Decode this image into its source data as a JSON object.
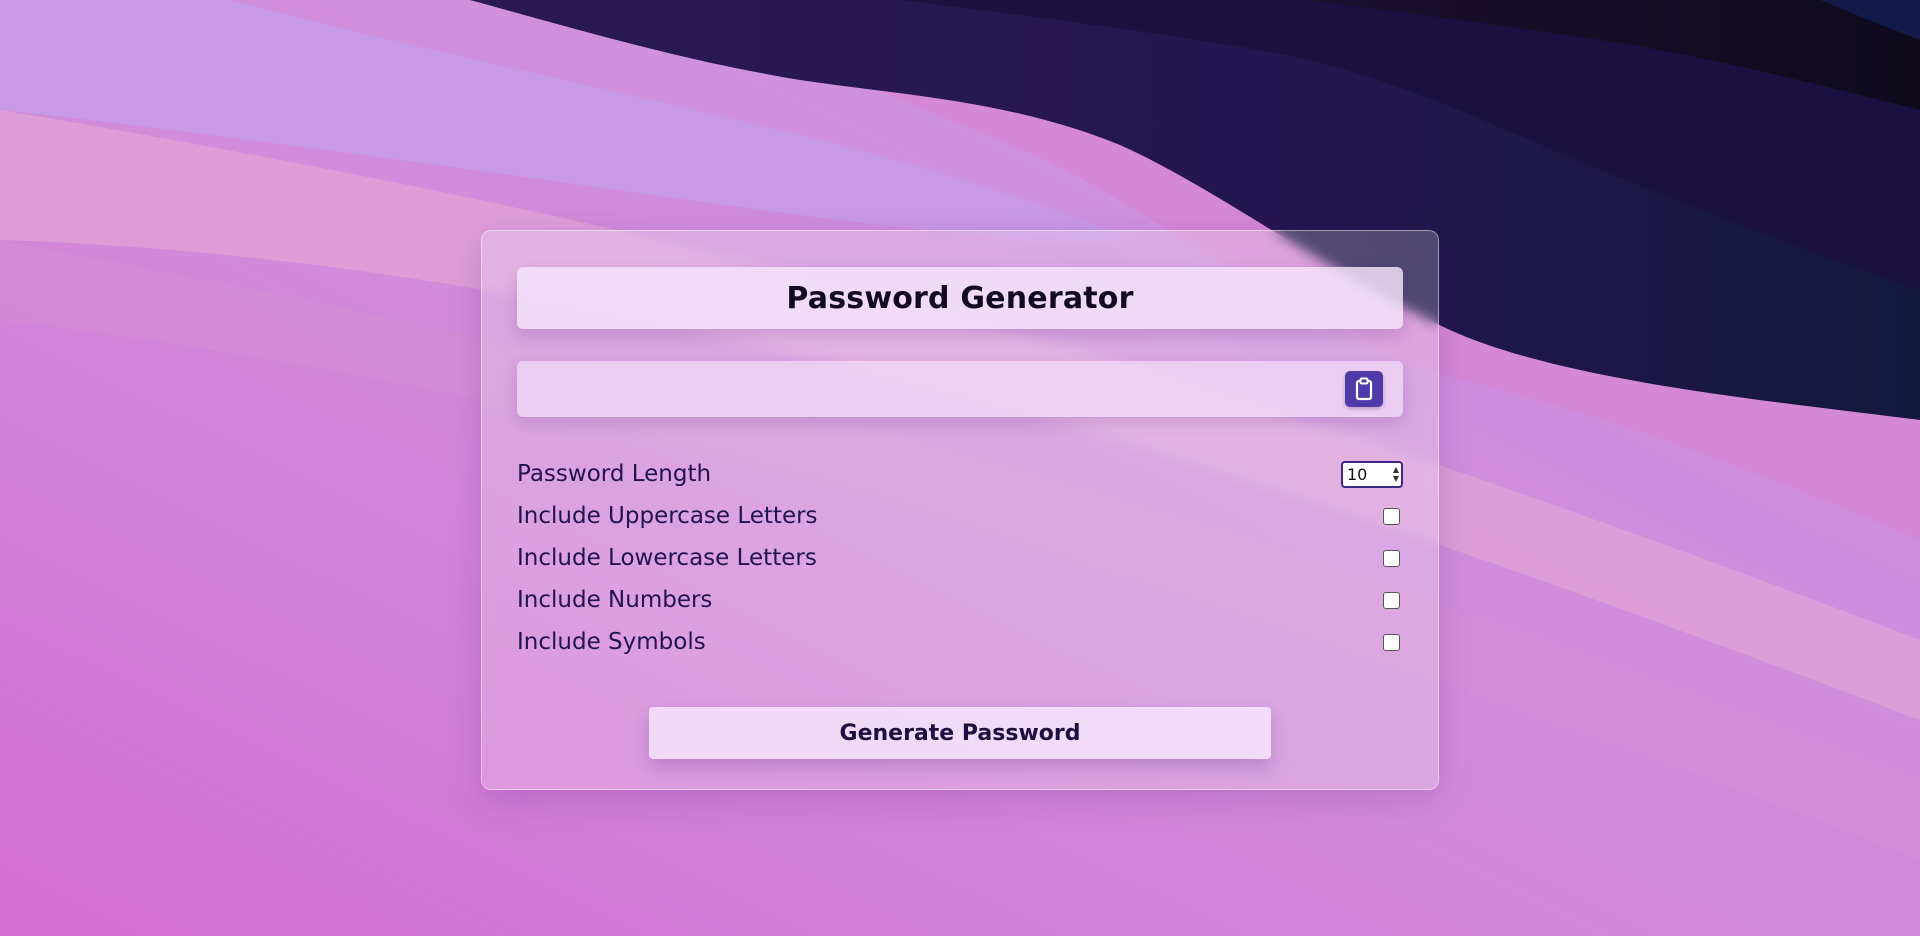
{
  "app": {
    "title": "Password Generator"
  },
  "output": {
    "value": "",
    "placeholder": ""
  },
  "copy_button": {
    "icon": "clipboard-icon"
  },
  "options": {
    "length": {
      "label": "Password Length",
      "value": "10"
    },
    "uppercase": {
      "label": "Include Uppercase Letters",
      "checked": false
    },
    "lowercase": {
      "label": "Include Lowercase Letters",
      "checked": false
    },
    "numbers": {
      "label": "Include Numbers",
      "checked": false
    },
    "symbols": {
      "label": "Include Symbols",
      "checked": false
    }
  },
  "generate_button": {
    "label": "Generate Password"
  },
  "colors": {
    "accent": "#4e3aa9",
    "text": "#231252",
    "wallpaper_pink": "#d84cc6",
    "wallpaper_dark": "#1d1440"
  }
}
